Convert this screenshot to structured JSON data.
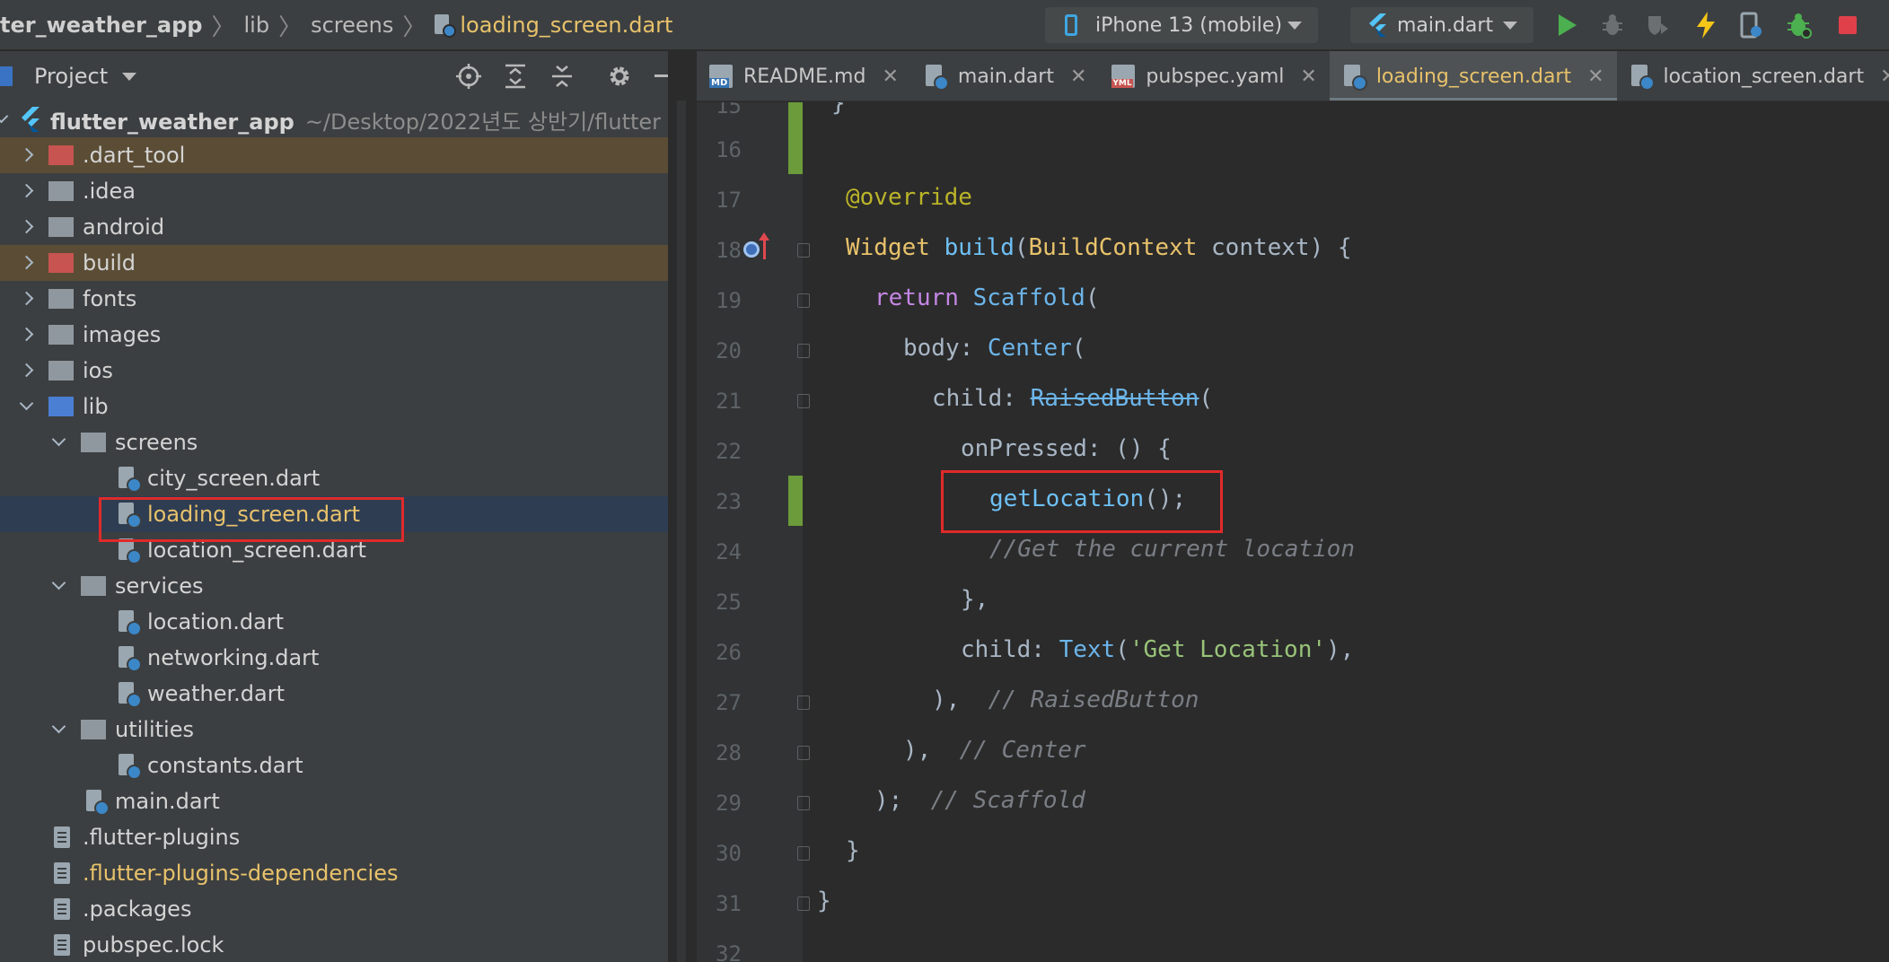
{
  "breadcrumb": {
    "items": [
      "ter_weather_app",
      "lib",
      "screens"
    ],
    "current_file": "loading_screen.dart"
  },
  "toolbar": {
    "device": "iPhone 13 (mobile)",
    "run_config": "main.dart",
    "accent_run": "#4caf50",
    "accent_stop": "#e0404a"
  },
  "project_panel": {
    "title": "Project",
    "tree": [
      {
        "label": "flutter_weather_app",
        "hint": "~/Desktop/2022년도 상반기/flutter",
        "kind": "root"
      },
      {
        "label": ".dart_tool",
        "kind": "folder",
        "color": "red",
        "state": "collapsed"
      },
      {
        "label": ".idea",
        "kind": "folder",
        "color": "grey",
        "state": "collapsed"
      },
      {
        "label": "android",
        "kind": "folder",
        "color": "grey",
        "state": "collapsed"
      },
      {
        "label": "build",
        "kind": "folder",
        "color": "red",
        "state": "collapsed"
      },
      {
        "label": "fonts",
        "kind": "folder",
        "color": "grey",
        "state": "collapsed"
      },
      {
        "label": "images",
        "kind": "folder",
        "color": "grey",
        "state": "collapsed"
      },
      {
        "label": "ios",
        "kind": "folder",
        "color": "grey",
        "state": "collapsed"
      },
      {
        "label": "lib",
        "kind": "folder",
        "color": "blue",
        "state": "expanded"
      },
      {
        "label": "screens",
        "kind": "folder",
        "color": "grey",
        "state": "expanded"
      },
      {
        "label": "city_screen.dart",
        "kind": "dart"
      },
      {
        "label": "loading_screen.dart",
        "kind": "dart",
        "selected": true
      },
      {
        "label": "location_screen.dart",
        "kind": "dart"
      },
      {
        "label": "services",
        "kind": "folder",
        "color": "grey",
        "state": "expanded"
      },
      {
        "label": "location.dart",
        "kind": "dart"
      },
      {
        "label": "networking.dart",
        "kind": "dart"
      },
      {
        "label": "weather.dart",
        "kind": "dart"
      },
      {
        "label": "utilities",
        "kind": "folder",
        "color": "grey",
        "state": "expanded"
      },
      {
        "label": "constants.dart",
        "kind": "dart"
      },
      {
        "label": "main.dart",
        "kind": "dart"
      },
      {
        "label": ".flutter-plugins",
        "kind": "file"
      },
      {
        "label": ".flutter-plugins-dependencies",
        "kind": "file"
      },
      {
        "label": ".packages",
        "kind": "file"
      },
      {
        "label": "pubspec.lock",
        "kind": "file"
      }
    ]
  },
  "tabs": [
    {
      "label": "README.md",
      "icon": "markdown-file-icon"
    },
    {
      "label": "main.dart",
      "icon": "dart-file-icon"
    },
    {
      "label": "pubspec.yaml",
      "icon": "yaml-file-icon"
    },
    {
      "label": "loading_screen.dart",
      "icon": "dart-file-icon",
      "active": true
    },
    {
      "label": "location_screen.dart",
      "icon": "dart-file-icon"
    }
  ],
  "editor": {
    "line_numbers": [
      "15",
      "16",
      "17",
      "18",
      "19",
      "20",
      "21",
      "22",
      "23",
      "24",
      "25",
      "26",
      "27",
      "28",
      "29",
      "30",
      "31",
      "32"
    ],
    "code": {
      "l15": "}",
      "l17_annot": "@override",
      "l18_type": "Widget",
      "l18_fn": "build",
      "l18_paren": "(",
      "l18_ctx_type": "BuildContext",
      "l18_rest": " context) {",
      "l19_kw": "return",
      "l19_cls": "Scaffold",
      "l19_paren": "(",
      "l20_key": "body: ",
      "l20_cls": "Center",
      "l20_paren": "(",
      "l21_key": "child: ",
      "l21_cls": "RaisedButton",
      "l21_paren": "(",
      "l22_text": "onPressed: () {",
      "l23_fn": "getLocation",
      "l23_rest": "();",
      "l24_cmt": "//Get the current location",
      "l25_text": "},",
      "l26_key": "child: ",
      "l26_cls": "Text",
      "l26_open": "(",
      "l26_str": "'Get Location'",
      "l26_close": "),",
      "l27_text": "),",
      "l27_cmt": "// RaisedButton",
      "l28_text": "),",
      "l28_cmt": "// Center",
      "l29_text": ");",
      "l29_cmt": "// Scaffold",
      "l30_text": "}",
      "l31_text": "}"
    }
  },
  "annotations": {
    "box_color": "#e02a2a"
  }
}
